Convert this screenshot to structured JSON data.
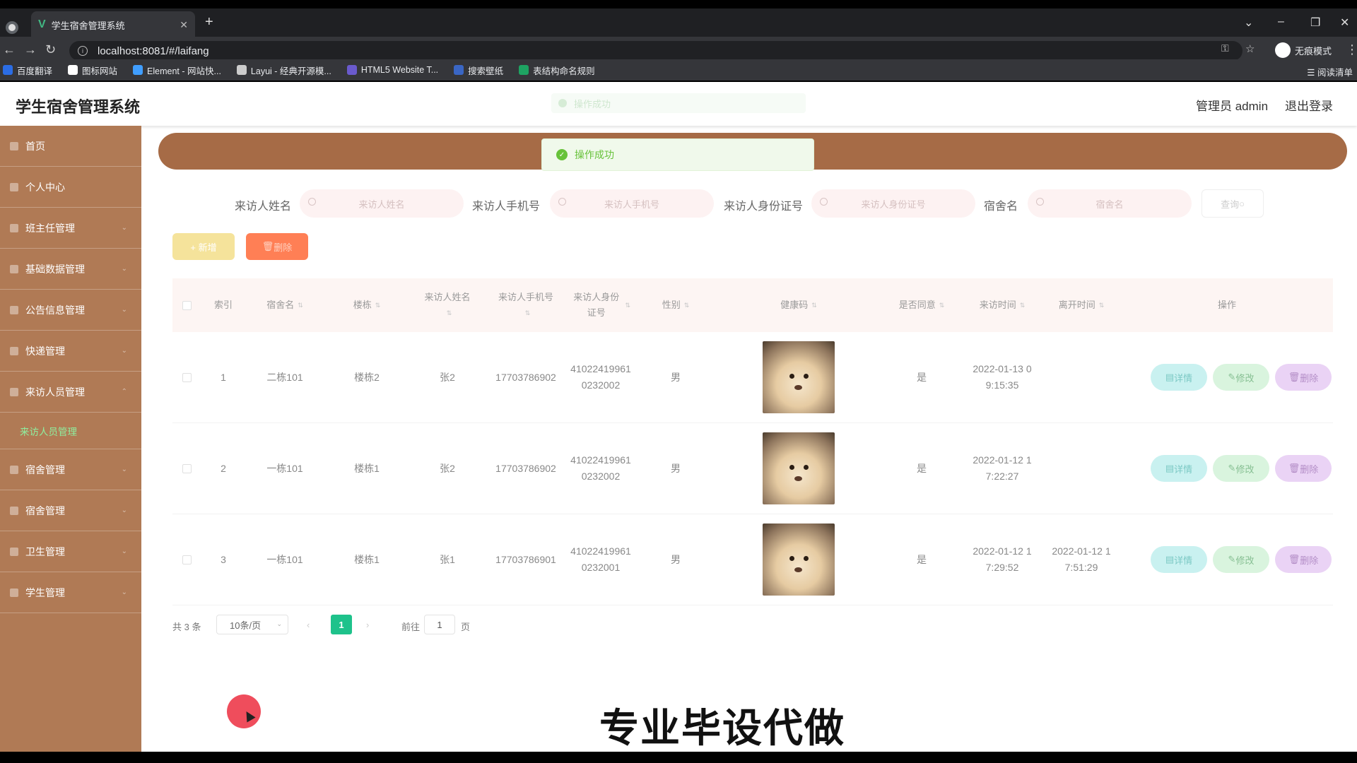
{
  "browser": {
    "tab_title": "学生宿舍管理系统",
    "url": "localhost:8081/#/laifang",
    "incognito_label": "无痕模式",
    "reading_list": "阅读清单",
    "bookmarks": [
      {
        "label": "百度翻译",
        "color": "#2b6de5"
      },
      {
        "label": "图标网站",
        "color": "#ffffff"
      },
      {
        "label": "Element - 网站快...",
        "color": "#409eff"
      },
      {
        "label": "Layui - 经典开源模...",
        "color": "#cccccc"
      },
      {
        "label": "HTML5 Website T...",
        "color": "#6a5acd"
      },
      {
        "label": "搜索壁纸",
        "color": "#3a66c4"
      },
      {
        "label": "表结构命名规则",
        "color": "#1ea362"
      }
    ]
  },
  "header": {
    "app_title": "学生宿舍管理系统",
    "admin_label": "管理员 admin",
    "logout_label": "退出登录",
    "ghost_message": "操作成功"
  },
  "toast": {
    "message": "操作成功",
    "color": "#67c23a"
  },
  "sidebar": {
    "items": [
      {
        "label": "首页",
        "icon": "home-icon"
      },
      {
        "label": "个人中心",
        "icon": "user-icon"
      },
      {
        "label": "班主任管理",
        "icon": "teacher-icon"
      },
      {
        "label": "基础数据管理",
        "icon": "data-icon"
      },
      {
        "label": "公告信息管理",
        "icon": "notice-icon"
      },
      {
        "label": "快递管理",
        "icon": "package-icon"
      },
      {
        "label": "来访人员管理",
        "icon": "visitor-icon"
      }
    ],
    "active_sub": "来访人员管理",
    "items_after": [
      {
        "label": "宿舍管理",
        "icon": "dorm-icon"
      },
      {
        "label": "宿舍管理",
        "icon": "dorm-icon"
      },
      {
        "label": "卫生管理",
        "icon": "hygiene-icon"
      },
      {
        "label": "学生管理",
        "icon": "student-icon"
      }
    ]
  },
  "search": {
    "fields": [
      {
        "label": "来访人姓名",
        "placeholder": "来访人姓名"
      },
      {
        "label": "来访人手机号",
        "placeholder": "来访人手机号"
      },
      {
        "label": "来访人身份证号",
        "placeholder": "来访人身份证号"
      },
      {
        "label": "宿舍名",
        "placeholder": "宿舍名"
      }
    ],
    "query_button": "查询"
  },
  "actions": {
    "add": "+ 新增",
    "delete": "删除"
  },
  "table": {
    "columns": [
      "索引",
      "宿舍名",
      "楼栋",
      "来访人姓名",
      "来访人手机号",
      "来访人身份证号",
      "性别",
      "健康码",
      "是否同意",
      "来访时间",
      "离开时间",
      "操作"
    ],
    "rows": [
      {
        "index": "1",
        "dorm": "二栋101",
        "building": "楼栋2",
        "name": "张2",
        "phone": "17703786902",
        "id_card_1": "41022419961",
        "id_card_2": "0232002",
        "gender": "男",
        "agree": "是",
        "visit_1": "2022-01-13 0",
        "visit_2": "9:15:35",
        "leave_1": "",
        "leave_2": ""
      },
      {
        "index": "2",
        "dorm": "一栋101",
        "building": "楼栋1",
        "name": "张2",
        "phone": "17703786902",
        "id_card_1": "41022419961",
        "id_card_2": "0232002",
        "gender": "男",
        "agree": "是",
        "visit_1": "2022-01-12 1",
        "visit_2": "7:22:27",
        "leave_1": "",
        "leave_2": ""
      },
      {
        "index": "3",
        "dorm": "一栋101",
        "building": "楼栋1",
        "name": "张1",
        "phone": "17703786901",
        "id_card_1": "41022419961",
        "id_card_2": "0232001",
        "gender": "男",
        "agree": "是",
        "visit_1": "2022-01-12 1",
        "visit_2": "7:29:52",
        "leave_1": "2022-01-12 1",
        "leave_2": "7:51:29"
      }
    ],
    "op_detail": "详情",
    "op_edit": "修改",
    "op_delete": "删除"
  },
  "pagination": {
    "total": "共 3 条",
    "page_size": "10条/页",
    "current": "1",
    "goto": "前往",
    "goto_value": "1",
    "page_suffix": "页"
  },
  "overlay": {
    "watermark": "专业毕设代做"
  }
}
